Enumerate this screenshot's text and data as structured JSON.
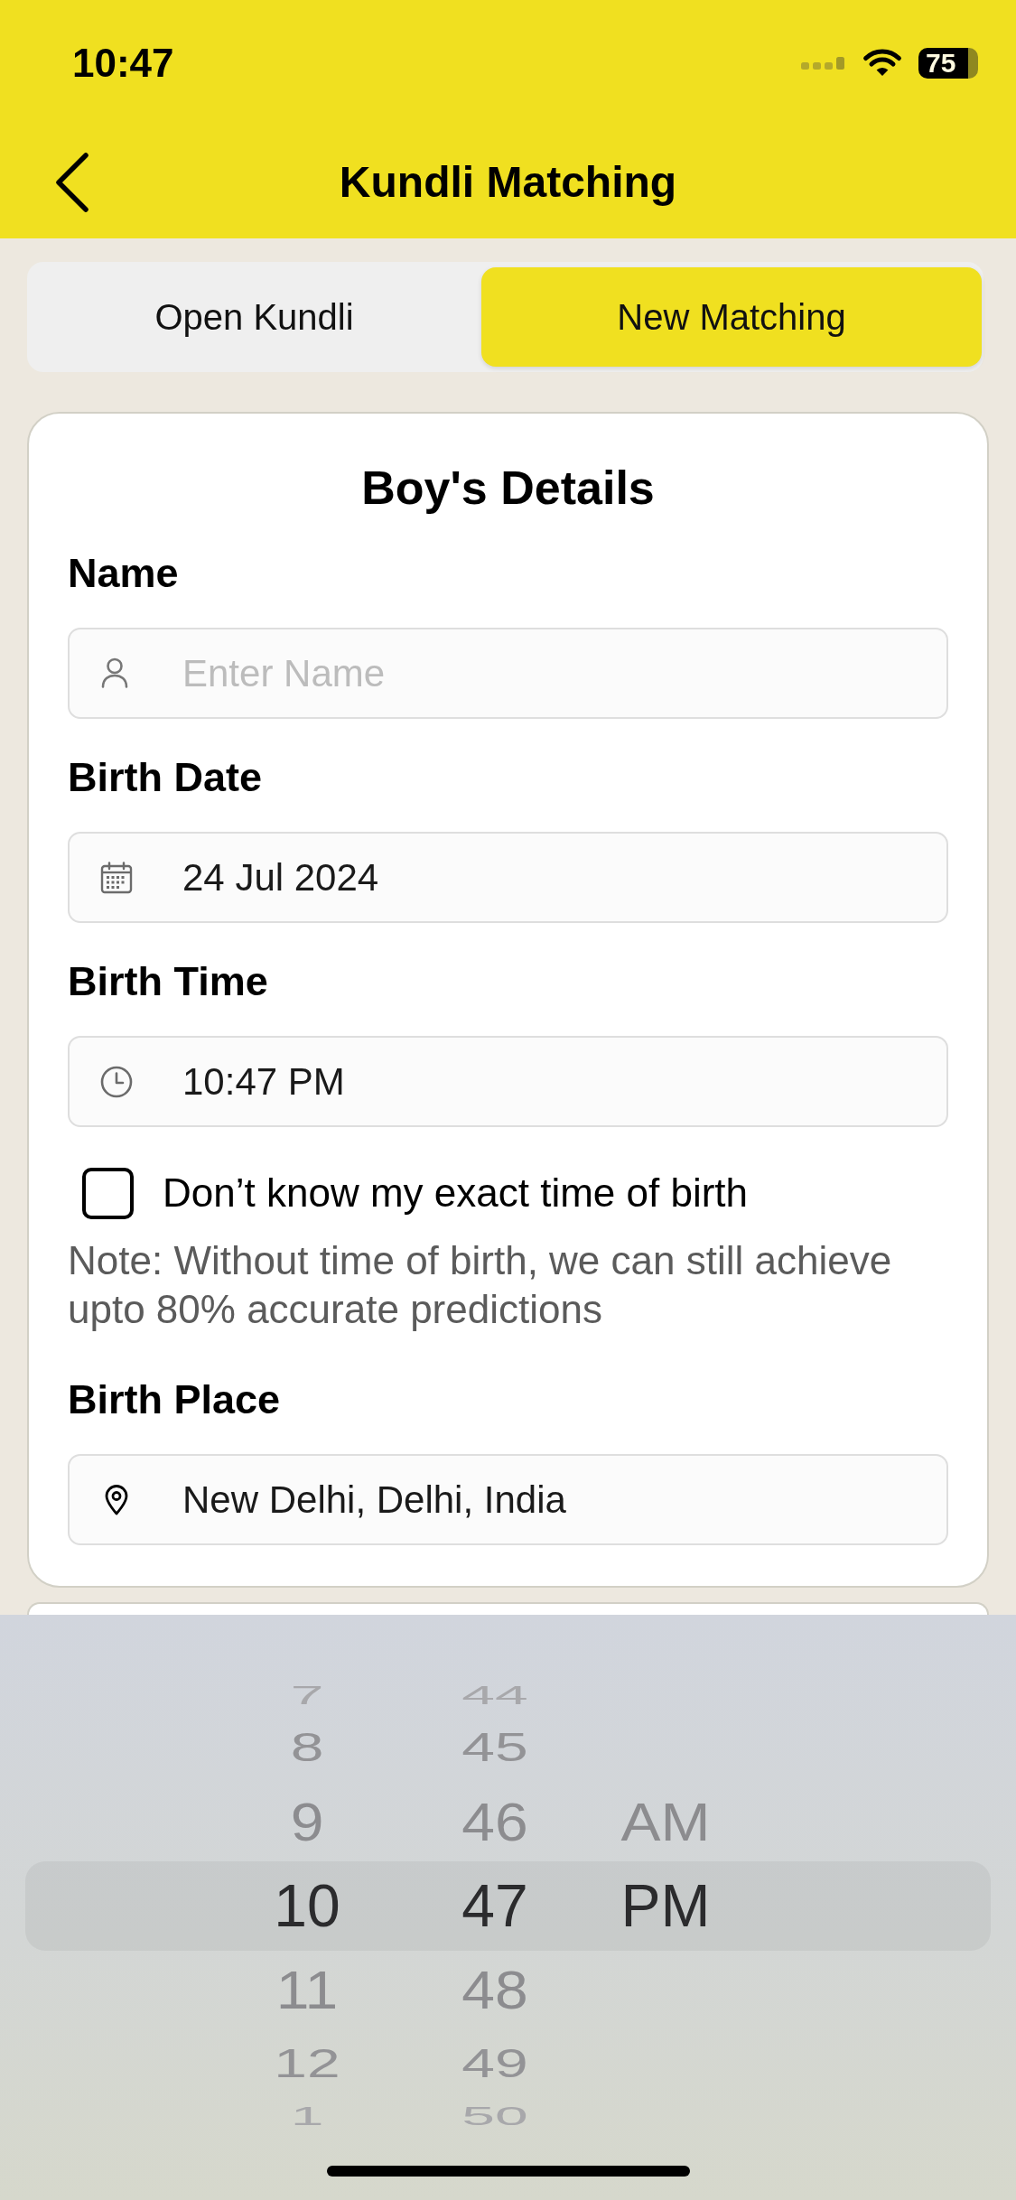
{
  "status_bar": {
    "time": "10:47",
    "battery": "75"
  },
  "header": {
    "title": "Kundli Matching"
  },
  "tabs": [
    {
      "label": "Open Kundli",
      "selected": false
    },
    {
      "label": "New Matching",
      "selected": true
    }
  ],
  "form": {
    "title": "Boy's Details",
    "items": [
      {
        "kind": "text_field",
        "label": "Name",
        "placeholder": "Enter Name"
      },
      {
        "kind": "date_field",
        "label": "Birth Date",
        "value": "24 Jul 2024"
      },
      {
        "kind": "time_field",
        "label": "Birth Time",
        "value": "10:47 PM"
      },
      {
        "kind": "checkbox",
        "label": "Don’t know my exact time of birth",
        "checked": false
      },
      {
        "kind": "note",
        "text": "Note: Without time of birth, we can still achieve upto 80% accurate predictions"
      },
      {
        "kind": "place_field",
        "label": "Birth Place",
        "value": "New Delhi, Delhi, India"
      }
    ]
  },
  "time_picker": {
    "columns": [
      {
        "items": [
          {
            "label": "7",
            "selected": false
          },
          {
            "label": "8",
            "selected": false
          },
          {
            "label": "9",
            "selected": false
          },
          {
            "label": "10",
            "selected": true
          },
          {
            "label": "11",
            "selected": false
          },
          {
            "label": "12",
            "selected": false
          },
          {
            "label": "1",
            "selected": false
          }
        ]
      },
      {
        "items": [
          {
            "label": "44",
            "selected": false
          },
          {
            "label": "45",
            "selected": false
          },
          {
            "label": "46",
            "selected": false
          },
          {
            "label": "47",
            "selected": true
          },
          {
            "label": "48",
            "selected": false
          },
          {
            "label": "49",
            "selected": false
          },
          {
            "label": "50",
            "selected": false
          }
        ]
      },
      {
        "items": [
          {
            "label": "AM",
            "selected": false
          },
          {
            "label": "PM",
            "selected": true
          }
        ]
      }
    ]
  }
}
